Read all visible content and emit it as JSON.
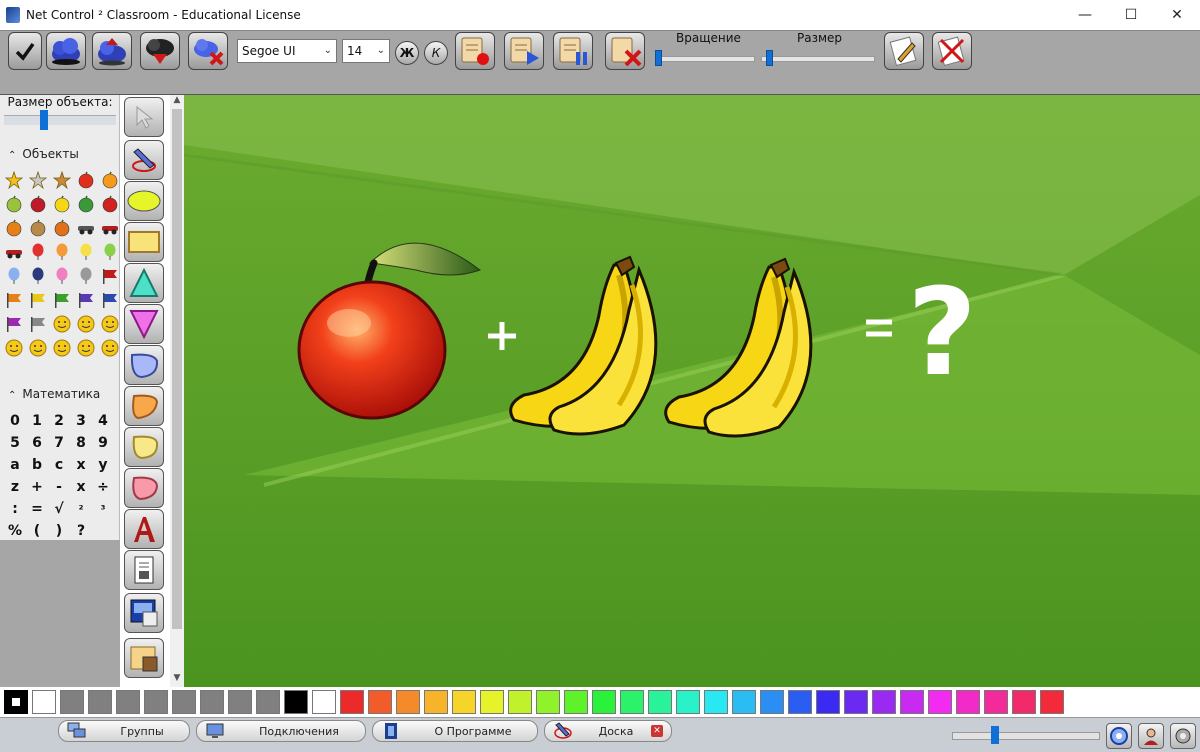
{
  "window": {
    "title": "Net Control ² Classroom - Educational License",
    "controls": [
      "minimize-icon",
      "maximize-icon",
      "close-icon"
    ]
  },
  "toolbar": {
    "font_family": "Segoe UI",
    "font_size": "14",
    "bold_label": "Ж",
    "italic_label": "К",
    "rotation_label": "Вращение",
    "size_label": "Размер",
    "rotation_value": 0,
    "size_value": 0.05
  },
  "left_panel": {
    "object_size_label": "Размер объекта:",
    "object_size_value": 0.35,
    "objects_section": "Объекты",
    "objects": [
      "star-gold-icon",
      "star-silver-icon",
      "star-bronze-icon",
      "apple-icon",
      "orange-icon",
      "pear-icon",
      "cherries-icon",
      "banana-icon",
      "watermelon-icon",
      "strawberry-icon",
      "pumpkin-icon",
      "cookie-icon",
      "basketball-icon",
      "bicycle-icon",
      "motorcycle-icon",
      "car-icon",
      "balloon-red-icon",
      "balloon-orange-icon",
      "balloon-yellow-icon",
      "balloon-green-icon",
      "balloon-blue-icon",
      "balloon-navy-icon",
      "balloon-pink-icon",
      "balloon-gray-icon",
      "flag-red-icon",
      "flag-orange-icon",
      "flag-yellow-icon",
      "flag-green-icon",
      "flag-purple-icon",
      "flag-blue-icon",
      "flag-violet-icon",
      "flag-gray-icon",
      "smiley-happy-icon",
      "smiley-neutral-icon",
      "smiley-sad-icon",
      "smiley-surprised-icon",
      "smiley-shocked-icon",
      "smiley-grin-icon",
      "smiley-wink-icon",
      "smiley-spiral-icon"
    ],
    "math_section": "Математика",
    "math_symbols": [
      "0",
      "1",
      "2",
      "3",
      "4",
      "5",
      "6",
      "7",
      "8",
      "9",
      "a",
      "b",
      "c",
      "x",
      "y",
      "z",
      "+",
      "-",
      "x",
      "÷",
      ":",
      "=",
      "√",
      "²",
      "³",
      "%",
      "(",
      ")",
      "?",
      ""
    ]
  },
  "palette": {
    "colors": [
      "#ffffff",
      "#808080",
      "#808080",
      "#808080",
      "#808080",
      "#808080",
      "#808080",
      "#808080",
      "#808080",
      "#000000",
      "#ffffff",
      "#ed2a2a",
      "#f25b2a",
      "#f58a2a",
      "#f7b42a",
      "#f7d42a",
      "#e6f22a",
      "#bff22a",
      "#8ff22a",
      "#5ef22a",
      "#2af23a",
      "#2af26a",
      "#2af29a",
      "#2af2c8",
      "#2ae8f2",
      "#2abcf2",
      "#2a8ef2",
      "#2a5ef2",
      "#3a2af2",
      "#6a2af2",
      "#9a2af2",
      "#c82af2",
      "#f22af2",
      "#f22ac8",
      "#f22a9a",
      "#f22a6a",
      "#f22a3a"
    ]
  },
  "taskbar": {
    "tabs": [
      "Группы",
      "Подключения",
      "О Программе",
      "Доска"
    ],
    "zoom_value": 0.28
  }
}
